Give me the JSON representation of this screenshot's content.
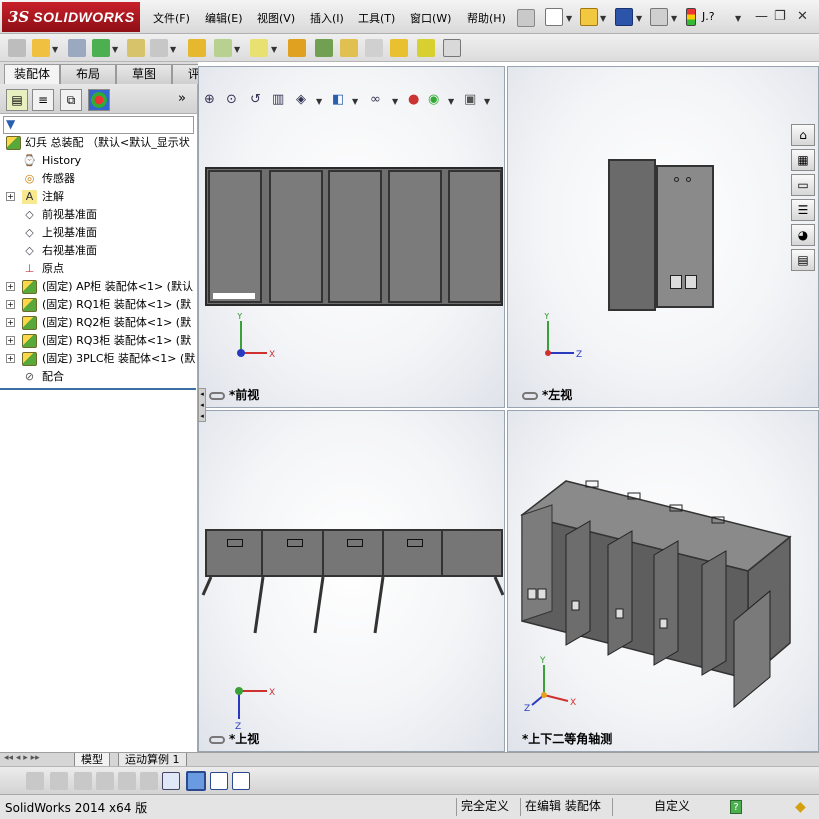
{
  "app": {
    "brand_prefix": "3S",
    "brand_name": "SOLIDWORKS"
  },
  "menu": [
    "文件(F)",
    "编辑(E)",
    "视图(V)",
    "插入(I)",
    "工具(T)",
    "窗口(W)",
    "帮助(H)"
  ],
  "help_shortcut": "J.?",
  "command_tabs": [
    "装配体",
    "布局",
    "草图",
    "评估"
  ],
  "feature_tree": {
    "root": "幻兵 总装配 （默认<默认_显示状",
    "items": [
      {
        "label": "History",
        "icon": "history-icon",
        "expandable": false
      },
      {
        "label": "传感器",
        "icon": "sensor-icon",
        "expandable": false
      },
      {
        "label": "注解",
        "icon": "annotation-icon",
        "expandable": true
      },
      {
        "label": "前视基准面",
        "icon": "plane-icon",
        "expandable": false
      },
      {
        "label": "上视基准面",
        "icon": "plane-icon",
        "expandable": false
      },
      {
        "label": "右视基准面",
        "icon": "plane-icon",
        "expandable": false
      },
      {
        "label": "原点",
        "icon": "origin-icon",
        "expandable": false
      },
      {
        "label": "(固定) AP柜 装配体<1> (默认",
        "icon": "assembly-icon",
        "expandable": true
      },
      {
        "label": "(固定) RQ1柜 装配体<1> (默",
        "icon": "assembly-icon",
        "expandable": true
      },
      {
        "label": "(固定) RQ2柜 装配体<1> (默",
        "icon": "assembly-icon",
        "expandable": true
      },
      {
        "label": "(固定) RQ3柜 装配体<1> (默",
        "icon": "assembly-icon",
        "expandable": true
      },
      {
        "label": "(固定) 3PLC柜 装配体<1> (默",
        "icon": "assembly-icon",
        "expandable": true
      },
      {
        "label": "配合",
        "icon": "mates-icon",
        "expandable": false
      }
    ]
  },
  "viewports": {
    "front": {
      "label": "*前视",
      "axes": [
        "Y",
        "X"
      ]
    },
    "left": {
      "label": "*左视",
      "axes": [
        "Y",
        "Z"
      ]
    },
    "top": {
      "label": "*上视",
      "axes": [
        "X",
        "Z"
      ]
    },
    "iso": {
      "label": "*上下二等角轴测",
      "axes": [
        "Y",
        "X",
        "Z"
      ]
    }
  },
  "bottom_tabs": [
    "模型",
    "运动算例 1"
  ],
  "status": {
    "app_version": "SolidWorks 2014 x64 版",
    "constraint": "完全定义",
    "mode": "在编辑 装配体",
    "units": "自定义",
    "help": "?"
  }
}
